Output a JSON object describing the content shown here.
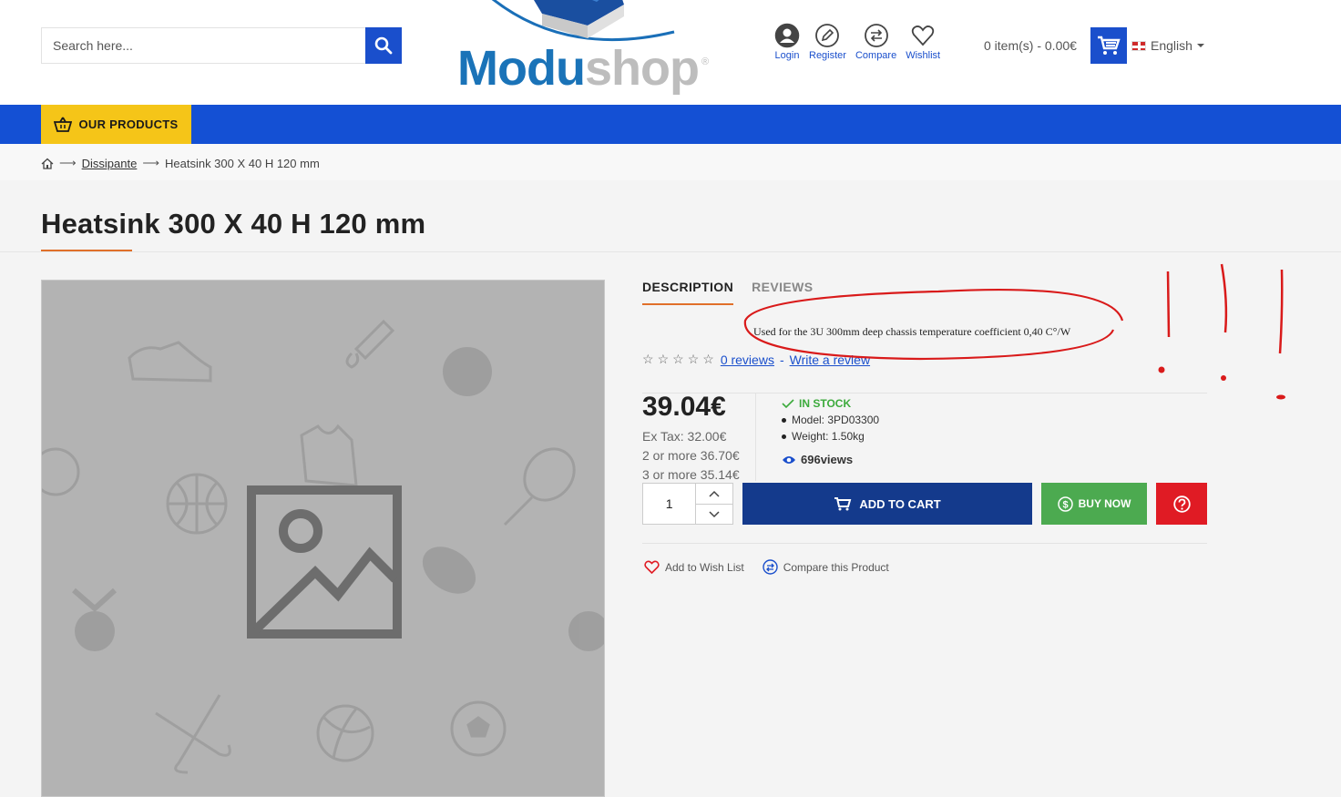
{
  "header": {
    "search_placeholder": "Search here...",
    "logo": {
      "part1": "Modu",
      "part2": "shop",
      "reg": "®"
    },
    "links": [
      {
        "label": "Login",
        "icon": "user-icon"
      },
      {
        "label": "Register",
        "icon": "pencil-icon"
      },
      {
        "label": "Compare",
        "icon": "compare-icon"
      },
      {
        "label": "Wishlist",
        "icon": "heart-icon"
      }
    ],
    "cart_summary": "0 item(s) - 0.00€",
    "language": "English"
  },
  "nav": {
    "our_products": "OUR PRODUCTS"
  },
  "breadcrumb": {
    "category": "Dissipante",
    "current": "Heatsink 300 X 40 H 120 mm"
  },
  "product": {
    "title": "Heatsink 300 X 40 H 120 mm",
    "tabs": [
      "DESCRIPTION",
      "REVIEWS"
    ],
    "description": "Used for the 3U 300mm deep chassis temperature coefficient 0,40 C°/W",
    "reviews_link": "0 reviews",
    "separator": "-",
    "write_review": "Write a review",
    "price": "39.04€",
    "ex_tax": "Ex Tax: 32.00€",
    "discount_1": "2 or more 36.70€",
    "discount_2": "3 or more 35.14€",
    "stock": "IN STOCK",
    "model": "Model: 3PD03300",
    "weight": "Weight: 1.50kg",
    "views": "696views",
    "quantity": "1",
    "add_to_cart": "ADD TO CART",
    "buy_now": "BUY NOW",
    "add_to_wishlist": "Add to Wish List",
    "compare_product": "Compare this Product"
  },
  "colors": {
    "primary_blue": "#1450d4",
    "dark_blue": "#143a8c",
    "accent_yellow": "#f5c518",
    "accent_orange": "#e0702a",
    "green": "#4caa50",
    "red": "#e01b24"
  }
}
